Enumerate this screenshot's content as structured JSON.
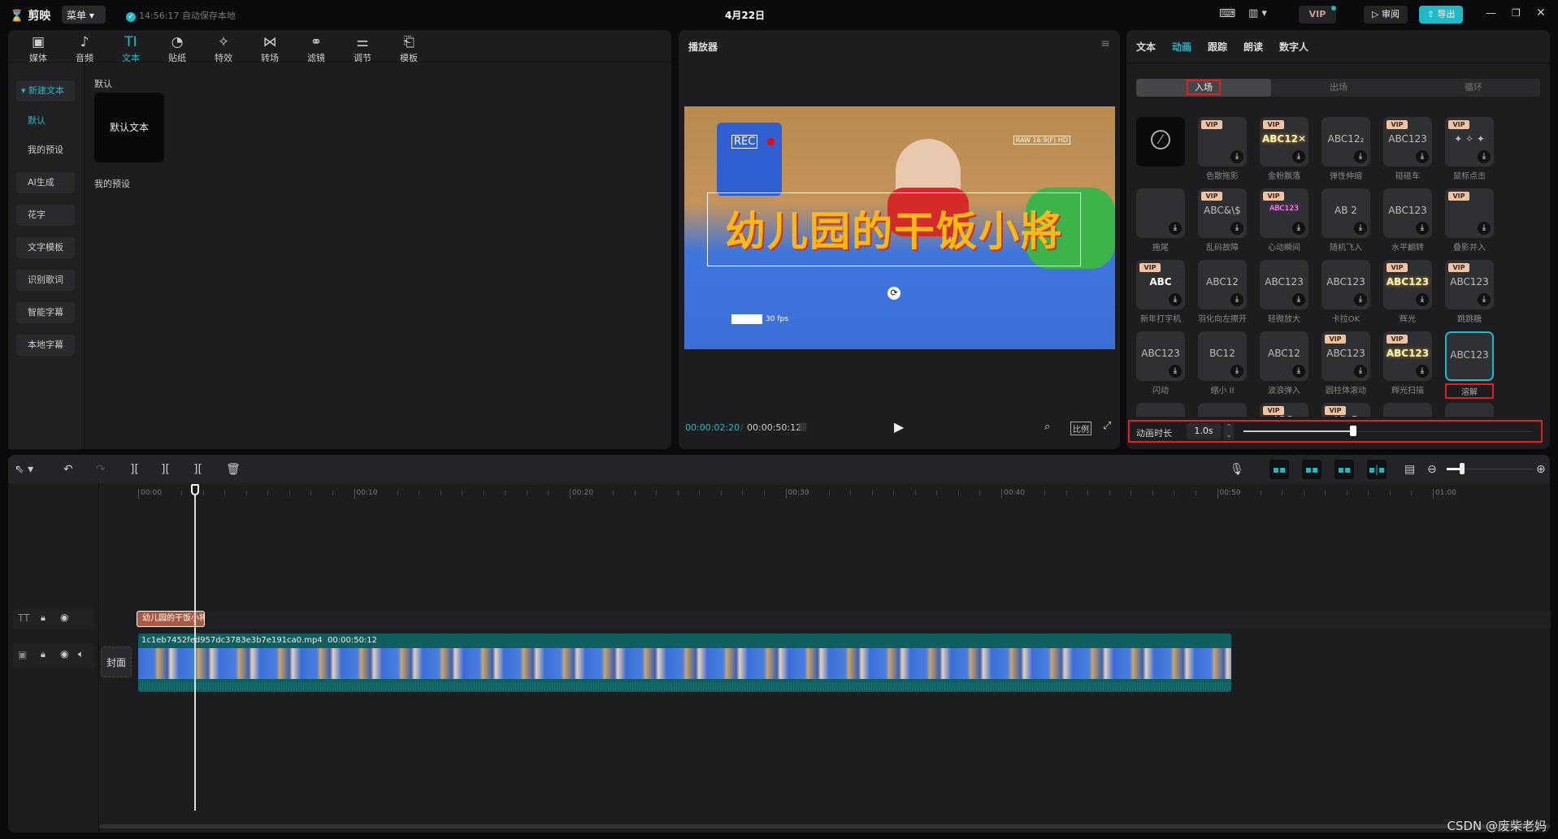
{
  "app": {
    "name": "剪映",
    "menu": "菜单",
    "save_status": "14:56:17 自动保存本地",
    "title": "4月22日",
    "vip": "VIP",
    "review": "审阅",
    "export": "导出",
    "accent": "#1fb9c8"
  },
  "toolbar": [
    {
      "icon": "media-icon",
      "glyph": "▣",
      "label": "媒体"
    },
    {
      "icon": "audio-icon",
      "glyph": "♪",
      "label": "音频"
    },
    {
      "icon": "text-icon",
      "glyph": "TI",
      "label": "文本",
      "active": true
    },
    {
      "icon": "sticker-icon",
      "glyph": "◔",
      "label": "贴纸"
    },
    {
      "icon": "effects-icon",
      "glyph": "✧",
      "label": "特效"
    },
    {
      "icon": "transition-icon",
      "glyph": "⋈",
      "label": "转场"
    },
    {
      "icon": "filter-icon",
      "glyph": "⚭",
      "label": "滤镜"
    },
    {
      "icon": "adjust-icon",
      "glyph": "⚌",
      "label": "调节"
    },
    {
      "icon": "template-icon",
      "glyph": "⎗",
      "label": "模板"
    }
  ],
  "sidebar": {
    "items": [
      {
        "label": "新建文本",
        "active": true
      },
      {
        "label": "默认",
        "sub": true,
        "active": true
      },
      {
        "label": "我的预设",
        "sub": true
      },
      {
        "label": "AI生成"
      },
      {
        "label": "花字"
      },
      {
        "label": "文字模板"
      },
      {
        "label": "识别歌词"
      },
      {
        "label": "智能字幕"
      },
      {
        "label": "本地字幕"
      }
    ]
  },
  "text_panel": {
    "section_default": "默认",
    "default_card": "默认文本",
    "section_presets": "我的预设"
  },
  "player": {
    "title": "播放器",
    "current_time": "00:00:02:20",
    "total_time": "00:00:50:12",
    "ratio": "比例",
    "overlay_text": "幼儿园的干饭小將",
    "rec": "REC",
    "fps": "30 fps",
    "cam_info": "RAW 16:9(F) HD"
  },
  "inspector": {
    "tabs": [
      "文本",
      "动画",
      "跟踪",
      "朗读",
      "数字人"
    ],
    "active_tab": 1,
    "subtabs": [
      "入场",
      "出场",
      "循环"
    ],
    "active_subtab": 0,
    "effects": [
      {
        "label": "",
        "none": true
      },
      {
        "label": "色散拖影",
        "vip": true,
        "pv": ""
      },
      {
        "label": "金粉飘落",
        "vip": true,
        "pv": "ABC12✕"
      },
      {
        "label": "弹性伸缩",
        "pv": "ABC12₂"
      },
      {
        "label": "碰碰车",
        "vip": true,
        "pv": "ABC123"
      },
      {
        "label": "鼠标点击",
        "vip": true,
        "pv": "✦ ✧ ✦"
      },
      {
        "label": "拖尾",
        "pv": ""
      },
      {
        "label": "乱码故障",
        "vip": true,
        "pv": "ABC&\\$"
      },
      {
        "label": "心动瞬间",
        "vip": true,
        "pv": "ABC123"
      },
      {
        "label": "随机飞入",
        "pv": "AB   2"
      },
      {
        "label": "水平翻转",
        "pv": "ABC123"
      },
      {
        "label": "叠影并入",
        "vip": true,
        "pv": ""
      },
      {
        "label": "新年打字机",
        "vip": true,
        "pv": "ABC"
      },
      {
        "label": "羽化向左擦开",
        "pv": "ABC12"
      },
      {
        "label": "轻微放大",
        "pv": "ABC123"
      },
      {
        "label": "卡拉OK",
        "pv": "ABC123"
      },
      {
        "label": "辉光",
        "vip": true,
        "pv": "ABC123"
      },
      {
        "label": "跳跳糖",
        "vip": true,
        "pv": "ABC123"
      },
      {
        "label": "闪动",
        "pv": "ABC123"
      },
      {
        "label": "缩小 II",
        "pv": "BC12"
      },
      {
        "label": "波浪弹入",
        "pv": "ABC12"
      },
      {
        "label": "圆柱体滚动",
        "vip": true,
        "pv": "ABC123"
      },
      {
        "label": "辉光扫描",
        "vip": true,
        "pv": "ABC123"
      },
      {
        "label": "溶解",
        "pv": "ABC123",
        "selected": true,
        "nodl": true
      },
      {
        "label": "",
        "pv": ""
      },
      {
        "label": "",
        "pv": ""
      },
      {
        "label": "",
        "vip": true,
        "pv": "ABC."
      },
      {
        "label": "",
        "vip": true,
        "pv": "ABcD"
      },
      {
        "label": "",
        "pv": ""
      },
      {
        "label": "",
        "pv": ""
      }
    ],
    "duration_label": "动画时长",
    "duration_value": "1.0s",
    "duration_fraction": 0.38
  },
  "timeline": {
    "ticks": [
      "00:00",
      "00:10",
      "00:20",
      "00:30",
      "00:40",
      "00:50",
      "01:00"
    ],
    "text_clip": "幼儿园的干饭小将",
    "video_clip_name": "1c1eb7452fed957dc3783e3b7e191ca0.mp4",
    "video_clip_duration": "00:00:50:12",
    "cover": "封面",
    "playhead_time": "00:00:02:20"
  },
  "watermark": "CSDN @废柴老妈"
}
